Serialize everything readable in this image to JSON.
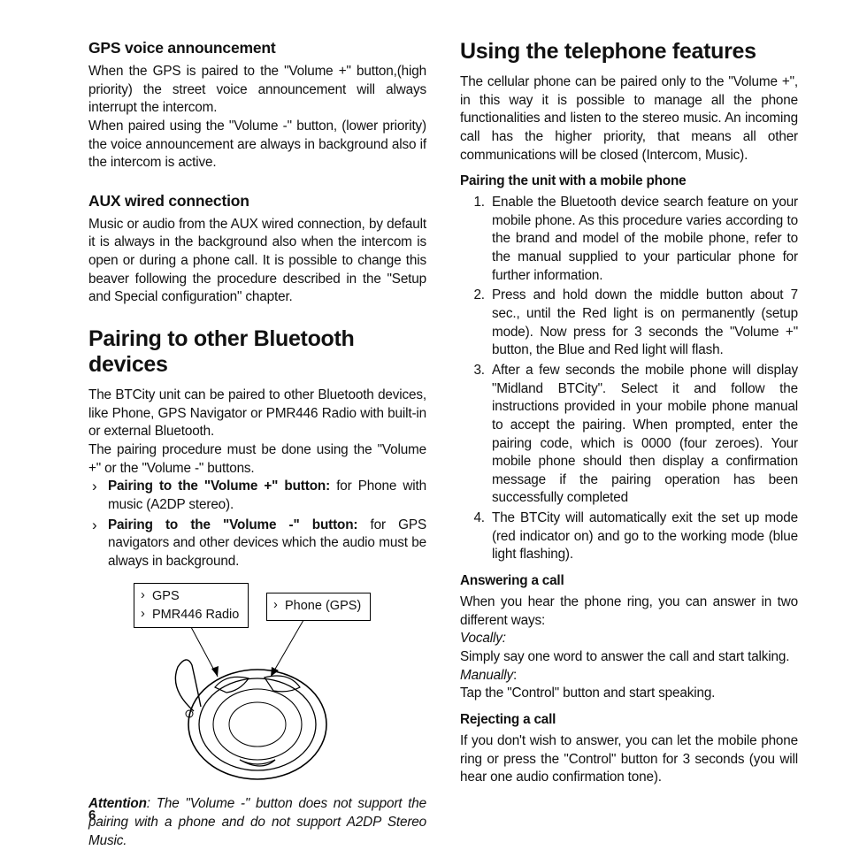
{
  "left": {
    "h3_gps": "GPS voice announcement",
    "p_gps_1": "When the GPS is paired to the \"Volume +\"  button,(high priority) the street voice announcement will always interrupt the intercom.",
    "p_gps_2": "When paired using the \"Volume -\" button, (lower priority) the voice announcement are always in background also if the intercom is active.",
    "h3_aux": "AUX wired connection",
    "p_aux": "Music or audio from the AUX wired connection, by default it is always in the background also when the intercom is open or during a phone call. It is possible to change this beaver following the procedure described in the \"Setup and Special configuration\" chapter.",
    "h2_pair": "Pairing to other Bluetooth devices",
    "p_pair_1": "The BTCity unit can be paired to other Bluetooth devices, like Phone, GPS Navigator or PMR446 Radio with built-in or external Bluetooth.",
    "p_pair_2": "The pairing procedure must be done using the \"Volume +\" or the \"Volume -\" buttons.",
    "li_1_b": "Pairing to the \"Volume +\" button:",
    "li_1_t": " for Phone with music (A2DP stereo).",
    "li_2_b": "Pairing to the \"Volume -\" button:",
    "li_2_t": " for GPS navigators and other devices which the audio must be always in background.",
    "fig_label_a1": "GPS",
    "fig_label_a2": "PMR446 Radio",
    "fig_label_b": "Phone (GPS)",
    "attn_b": "Attention",
    "attn_t": ": The \"Volume -\" button does not support the pairing with a phone and do not support A2DP Stereo Music."
  },
  "right": {
    "h2_tel": "Using the telephone features",
    "p_tel": "The cellular phone can be paired only to the \"Volume +\", in this way it is possible to manage all the phone functionalities and listen to the stereo music. An incoming call has the higher priority, that means all other communications will be closed (Intercom, Music).",
    "h4_pairmobile": "Pairing the unit with a mobile phone",
    "ol_1": "Enable the Bluetooth device search feature on your mobile phone. As this procedure varies according to the brand and model of the mobile phone, refer to the manual supplied to your particular phone for further information.",
    "ol_2": "Press and hold down the middle button about 7 sec., until the Red light is on permanently (setup mode). Now press for 3 seconds the \"Volume +\" button, the Blue and Red light will flash.",
    "ol_3": "After a few seconds the mobile phone will display \"Midland BTCity\". Select it and follow the instructions provided in your mobile phone manual to accept the pairing. When prompted, enter the pairing code, which is 0000 (four zeroes). Your mobile phone should then display a confirmation message if the pairing operation has been successfully completed",
    "ol_4": "The BTCity will automatically exit the set up mode (red indicator on) and go to the working mode (blue light flashing).",
    "h4_answer": "Answering a call",
    "p_ans_1": "When you hear the phone ring, you can answer in two different ways:",
    "p_voc": "Vocally:",
    "p_voc_t": "Simply say one word to answer the call and start talking.",
    "p_man": "Manually",
    "p_man_t": "Tap the \"Control\" button and start speaking.",
    "h4_reject": "Rejecting a call",
    "p_reject": "If you don't wish to answer, you can let the mobile phone ring or press the \"Control\" button for 3 seconds (you will hear one audio confirmation tone)."
  },
  "page_num": "6"
}
